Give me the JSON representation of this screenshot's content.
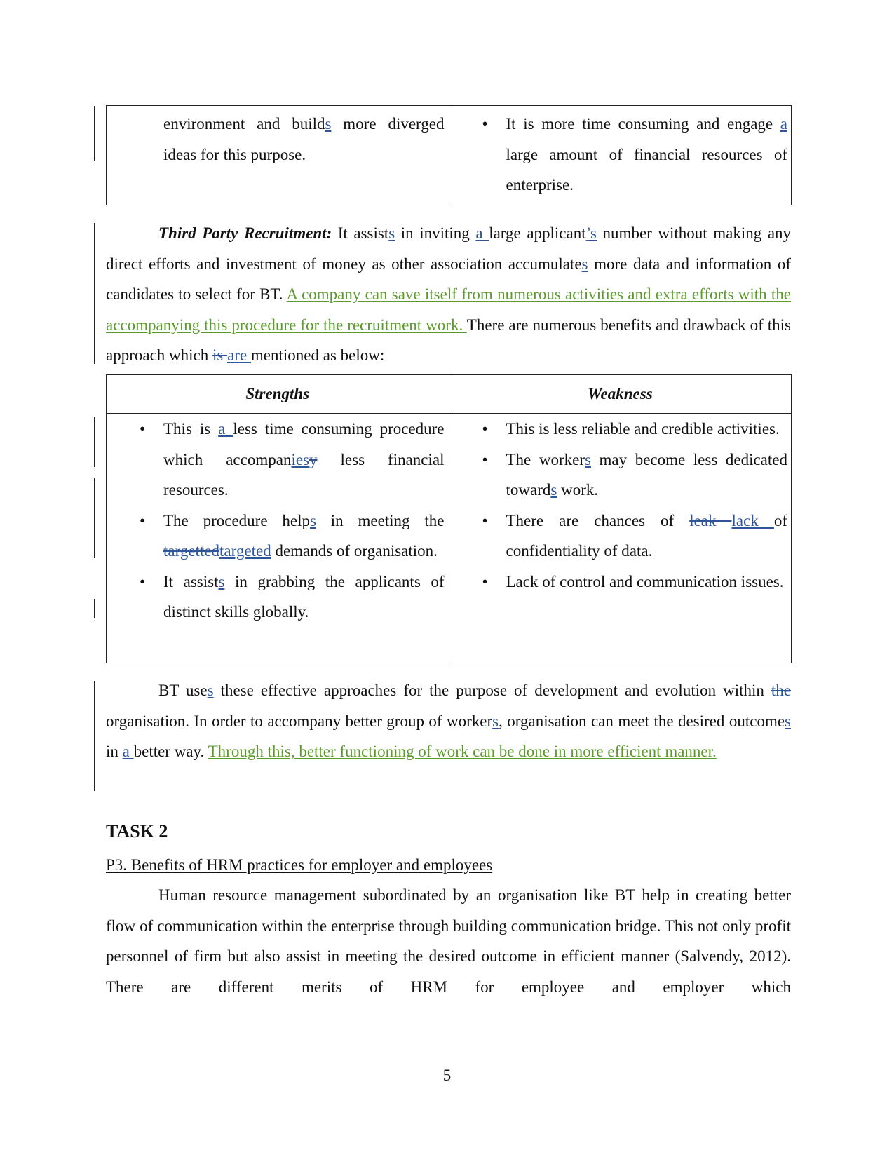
{
  "colors": {
    "insertion": "#2e5597",
    "moved_text": "#5b9b2b",
    "text": "#111111"
  },
  "table1": {
    "left": [
      {
        "t": "environment and build"
      },
      {
        "t": "s",
        "s": "ins"
      },
      {
        "t": " more diverged ideas for this purpose."
      }
    ],
    "right_bullets": [
      [
        {
          "t": "It is more time consuming and engage "
        },
        {
          "t": "a",
          "s": "ins"
        },
        {
          "t": " large amount of financial resources of enterprise."
        }
      ]
    ]
  },
  "para1": [
    {
      "t": "Third Party Recruitment:",
      "s": "bi"
    },
    {
      "t": " It assist"
    },
    {
      "t": "s",
      "s": "ins"
    },
    {
      "t": " in inviting "
    },
    {
      "t": "a ",
      "s": "ins"
    },
    {
      "t": "large applicant"
    },
    {
      "t": "’s",
      "s": "ins"
    },
    {
      "t": " number without making any direct efforts and investment of money as other association accumulate"
    },
    {
      "t": "s",
      "s": "ins"
    },
    {
      "t": " more data and information of candidates to select for BT. "
    },
    {
      "t": "A company can save itself from numerous activities and extra efforts with the accompanying this procedure for the recruitment work. ",
      "s": "mv"
    },
    {
      "t": "There are numerous benefits and drawback of this approach which "
    },
    {
      "t": "is ",
      "s": "del"
    },
    {
      "t": "are ",
      "s": "ins"
    },
    {
      "t": "mentioned as below:"
    }
  ],
  "table2": {
    "headers": [
      "Strengths",
      "Weakness"
    ],
    "strengths": [
      [
        {
          "t": "This is "
        },
        {
          "t": "a  ",
          "s": "ins"
        },
        {
          "t": "less time consuming procedure which accompan"
        },
        {
          "t": "ies",
          "s": "ins"
        },
        {
          "t": "y",
          "s": "del"
        },
        {
          "t": " less financial resources."
        }
      ],
      [
        {
          "t": "The procedure help"
        },
        {
          "t": "s",
          "s": "ins"
        },
        {
          "t": " in meeting the "
        },
        {
          "t": "targetted",
          "s": "del"
        },
        {
          "t": "targeted",
          "s": "ins"
        },
        {
          "t": " demands of organisation."
        }
      ],
      [
        {
          "t": "It assist"
        },
        {
          "t": "s",
          "s": "ins"
        },
        {
          "t": " in grabbing the applicants of distinct skills globally."
        }
      ]
    ],
    "weakness": [
      [
        {
          "t": "This is less reliable and credible activities."
        }
      ],
      [
        {
          "t": "The worker"
        },
        {
          "t": "s",
          "s": "ins"
        },
        {
          "t": " may become less dedicated toward"
        },
        {
          "t": "s",
          "s": "ins"
        },
        {
          "t": " work."
        }
      ],
      [
        {
          "t": "There are chances of "
        },
        {
          "t": "leak ",
          "s": "del"
        },
        {
          "t": "lack ",
          "s": "ins"
        },
        {
          "t": " of confidentiality of data."
        }
      ],
      [
        {
          "t": "Lack of control and communication issues."
        }
      ]
    ]
  },
  "para2": [
    {
      "t": "BT use"
    },
    {
      "t": "s",
      "s": "ins"
    },
    {
      "t": " these effective approaches for the purpose of development and evolution within "
    },
    {
      "t": "the ",
      "s": "del"
    },
    {
      "t": "organisation. In order to accompany better group of worker"
    },
    {
      "t": "s",
      "s": "ins"
    },
    {
      "t": ", organisation can meet the desired outcome"
    },
    {
      "t": "s",
      "s": "ins"
    },
    {
      "t": " in "
    },
    {
      "t": "a ",
      "s": "ins"
    },
    {
      "t": "better way. "
    },
    {
      "t": "Through this, better functioning of work can be done in more efficient manner. ",
      "s": "mv"
    }
  ],
  "task_heading": "TASK 2",
  "section_heading": "P3. Benefits of HRM practices for employer and employees",
  "para3": [
    {
      "t": "Human resource management subordinated by an organisation like BT help in creating better flow of communication within the enterprise through building communication bridge. This not only profit personnel of firm but also assist in meeting the desired outcome in efficient manner (Salvendy, 2012). There are different merits of HRM for employee and employer which"
    }
  ],
  "page_number": "5"
}
